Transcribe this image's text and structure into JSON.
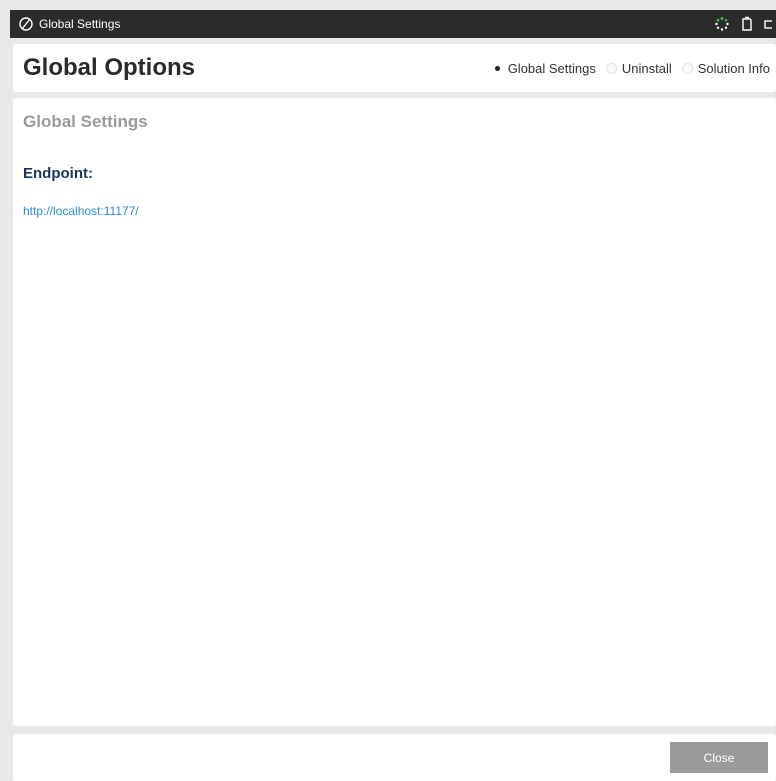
{
  "window": {
    "title": "Global Settings",
    "logo_icon": "slashed-circle-icon",
    "titlebar_icons": [
      "loading-spinner-icon",
      "document-icon",
      "window-icon"
    ],
    "spinner_color": "#4caf50"
  },
  "header": {
    "title": "Global Options",
    "nav_options": [
      {
        "label": "Global Settings",
        "selected": true
      },
      {
        "label": "Uninstall",
        "selected": false
      },
      {
        "label": "Solution Info",
        "selected": false
      }
    ]
  },
  "main": {
    "section_title": "Global Settings",
    "endpoint_label": "Endpoint:",
    "endpoint_url": "http://localhost:11177/"
  },
  "footer": {
    "close_label": "Close"
  },
  "colors": {
    "titlebar_bg": "#2b2b2b",
    "link": "#2a8fd6",
    "endpoint_label": "#1d3557",
    "button_bg": "#9b9b9b"
  }
}
